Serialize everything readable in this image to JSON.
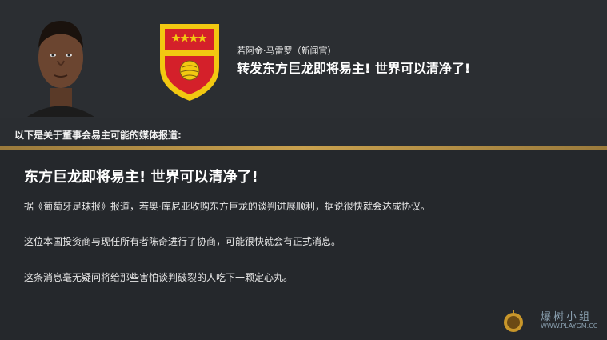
{
  "news": {
    "sender": "若阿金·马雷罗（新闻官）",
    "headline": "转发东方巨龙即将易主! 世界可以清净了!"
  },
  "section": {
    "label": "以下是关于董事会易主可能的媒体报道:"
  },
  "article": {
    "title": "东方巨龙即将易主! 世界可以清净了!",
    "paragraphs": [
      "据《葡萄牙足球报》报道，若奥·库尼亚收购东方巨龙的谈判进展顺利，据说很快就会达成协议。",
      "这位本国投资商与现任所有者陈奇进行了协商，可能很快就会有正式消息。",
      "这条消息毫无疑问将给那些害怕谈判破裂的人吃下一颗定心丸。"
    ]
  },
  "watermark": {
    "text": "爆树小组",
    "url": "WWW.PLAYGM.CC"
  },
  "colors": {
    "background": "#2a2d31",
    "accent_gold": "#c9a14e",
    "crest_red": "#d4202a",
    "crest_yellow": "#f2c811"
  },
  "icons": {
    "avatar": "press-officer-portrait",
    "crest": "club-crest-icon"
  }
}
